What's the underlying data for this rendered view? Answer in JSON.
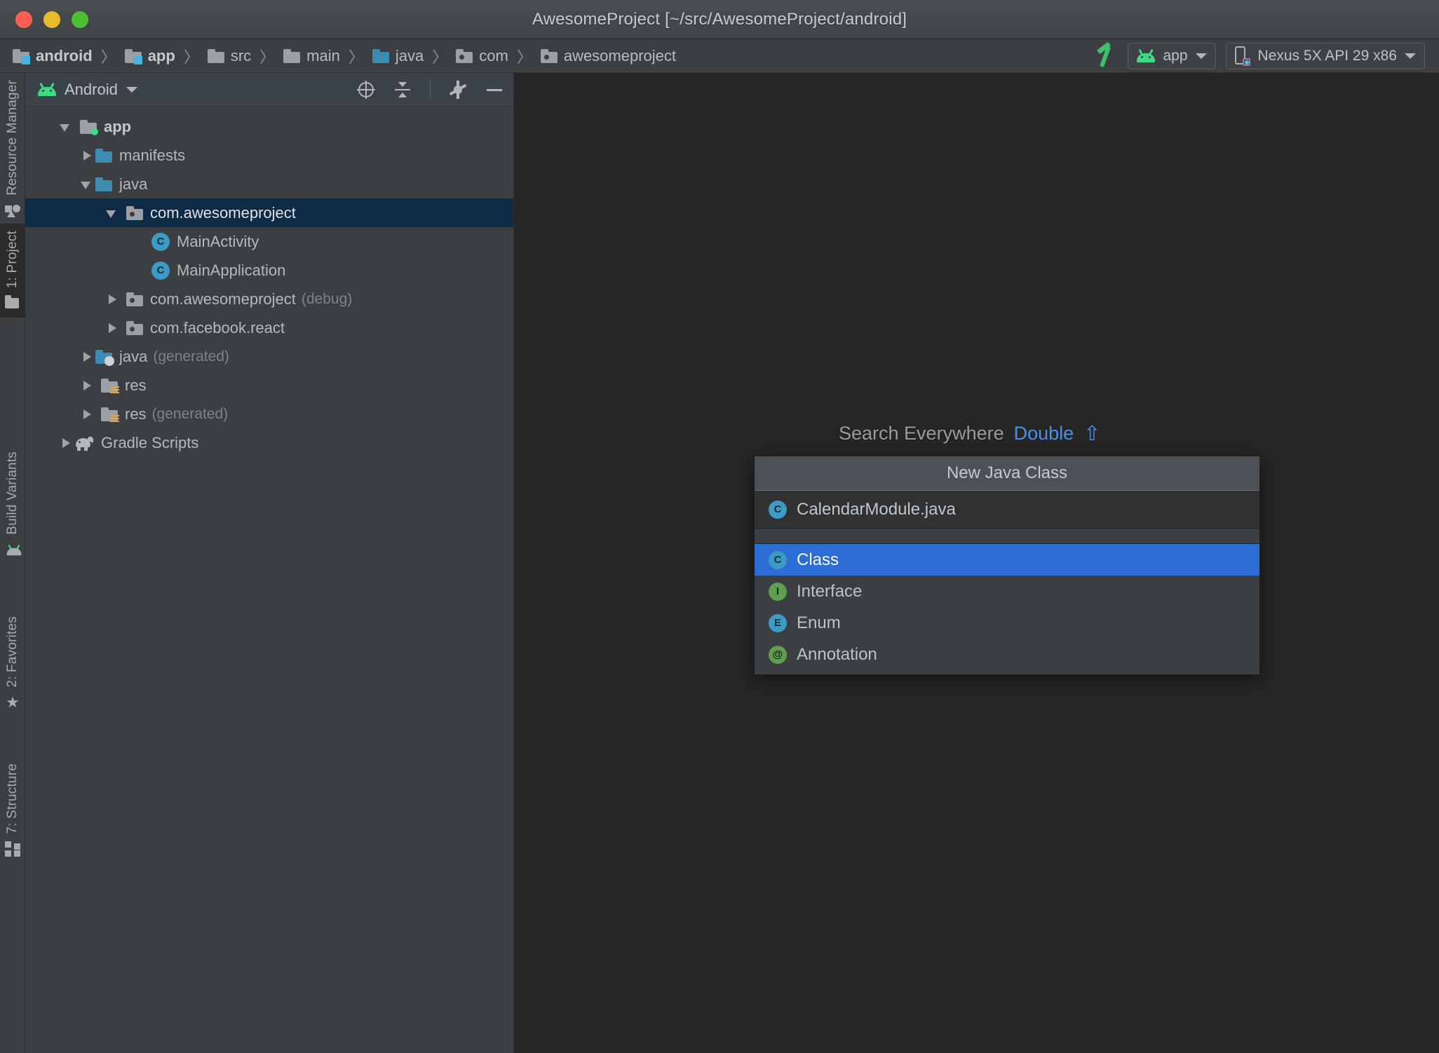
{
  "window": {
    "title": "AwesomeProject [~/src/AwesomeProject/android]",
    "controls": {
      "close": "close-button",
      "minimize": "minimize-button",
      "zoom": "zoom-button"
    }
  },
  "breadcrumb": [
    {
      "label": "android",
      "icon": "module-folder-icon",
      "bold": true
    },
    {
      "label": "app",
      "icon": "module-folder-icon",
      "bold": true
    },
    {
      "label": "src",
      "icon": "folder-icon",
      "bold": false
    },
    {
      "label": "main",
      "icon": "folder-icon",
      "bold": false
    },
    {
      "label": "java",
      "icon": "source-folder-icon",
      "bold": false
    },
    {
      "label": "com",
      "icon": "package-folder-icon",
      "bold": false
    },
    {
      "label": "awesomeproject",
      "icon": "package-folder-icon",
      "bold": false
    }
  ],
  "separator": "〉",
  "toolbar": {
    "build_icon": "hammer-icon",
    "run_config": {
      "label": "app",
      "icon": "android-icon"
    },
    "device": {
      "label": "Nexus 5X API 29 x86",
      "icon": "device-icon"
    }
  },
  "tool_strip": {
    "top": [
      {
        "label": "Resource Manager",
        "icon": "shapes-icon",
        "active": false
      },
      {
        "label": "1: Project",
        "icon": "folder-icon",
        "active": true
      }
    ],
    "bottom": [
      {
        "label": "Build Variants",
        "icon": "android-icon",
        "active": false
      },
      {
        "label": "2: Favorites",
        "icon": "star-icon",
        "active": false
      },
      {
        "label": "7: Structure",
        "icon": "blocks-icon",
        "active": false
      }
    ]
  },
  "panel": {
    "title": "Android",
    "actions": [
      {
        "name": "locate-icon"
      },
      {
        "name": "collapse-all-icon"
      },
      {
        "name": "settings-gear-icon"
      },
      {
        "name": "hide-panel-icon"
      }
    ]
  },
  "tree": [
    {
      "indent": 0,
      "twisty": "open",
      "icon": "module-folder-icon",
      "label": "app",
      "suffix": "",
      "bold": true,
      "selected": false
    },
    {
      "indent": 1,
      "twisty": "closed",
      "icon": "blue-folder-icon",
      "label": "manifests",
      "suffix": "",
      "bold": false,
      "selected": false
    },
    {
      "indent": 1,
      "twisty": "open",
      "icon": "blue-folder-icon",
      "label": "java",
      "suffix": "",
      "bold": false,
      "selected": false
    },
    {
      "indent": 2,
      "twisty": "open",
      "icon": "package-folder-icon",
      "label": "com.awesomeproject",
      "suffix": "",
      "bold": false,
      "selected": true
    },
    {
      "indent": 3,
      "twisty": "none",
      "icon": "java-class-icon",
      "label": "MainActivity",
      "suffix": "",
      "bold": false,
      "selected": false
    },
    {
      "indent": 3,
      "twisty": "none",
      "icon": "java-class-icon",
      "label": "MainApplication",
      "suffix": "",
      "bold": false,
      "selected": false
    },
    {
      "indent": 2,
      "twisty": "closed",
      "icon": "package-folder-icon",
      "label": "com.awesomeproject",
      "suffix": "(debug)",
      "bold": false,
      "selected": false
    },
    {
      "indent": 2,
      "twisty": "closed",
      "icon": "package-folder-icon",
      "label": "com.facebook.react",
      "suffix": "",
      "bold": false,
      "selected": false
    },
    {
      "indent": 1,
      "twisty": "closed",
      "icon": "generated-java-icon",
      "label": "java",
      "suffix": "(generated)",
      "bold": false,
      "selected": false
    },
    {
      "indent": 1,
      "twisty": "closed",
      "icon": "res-folder-icon",
      "label": "res",
      "suffix": "",
      "bold": false,
      "selected": false
    },
    {
      "indent": 1,
      "twisty": "closed",
      "icon": "res-folder-icon",
      "label": "res",
      "suffix": "(generated)",
      "bold": false,
      "selected": false
    },
    {
      "indent": 0,
      "twisty": "closed",
      "icon": "gradle-icon",
      "label": "Gradle Scripts",
      "suffix": "",
      "bold": false,
      "selected": false
    }
  ],
  "search_everywhere": {
    "label": "Search Everywhere",
    "shortcut": "Double",
    "shift_glyph": "⇧"
  },
  "popup": {
    "header": "New Java Class",
    "input_value": "CalendarModule.java",
    "input_icon": "java-class-icon",
    "items": [
      {
        "label": "Class",
        "icon": "class-icon",
        "badge": "C",
        "color": "blue",
        "selected": true
      },
      {
        "label": "Interface",
        "icon": "interface-icon",
        "badge": "I",
        "color": "green",
        "selected": false
      },
      {
        "label": "Enum",
        "icon": "enum-icon",
        "badge": "E",
        "color": "blue",
        "selected": false
      },
      {
        "label": "Annotation",
        "icon": "annotation-icon",
        "badge": "@",
        "color": "green",
        "selected": false
      }
    ]
  },
  "colors": {
    "accent_blue": "#2d6dd6",
    "link_blue": "#4a90e8",
    "selection_navy": "#0d2b45",
    "editor_bg": "#262626",
    "chrome_bg": "#3c3f41",
    "android_green": "#3ddc84"
  }
}
